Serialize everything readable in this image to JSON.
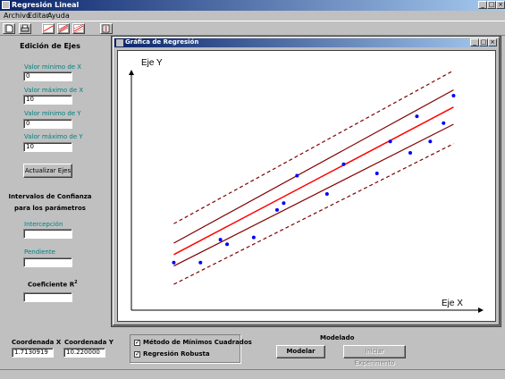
{
  "window": {
    "title": "Regresión Lineal"
  },
  "menu": {
    "items": [
      "Archivo",
      "Editar",
      "Ayuda"
    ]
  },
  "toolbar": {
    "icons": [
      "new-file-icon",
      "print-icon",
      "chart-line-icon",
      "chart-scatter-icon",
      "chart-bands-icon",
      "exit-icon"
    ]
  },
  "axes_panel": {
    "title": "Edición de Ejes",
    "xmin_label": "Valor mínimo de X",
    "xmin_value": "0",
    "xmax_label": "Valor máximo de X",
    "xmax_value": "10",
    "ymin_label": "Valor mínimo de Y",
    "ymin_value": "0",
    "ymax_label": "Valor máximo de Y",
    "ymax_value": "10",
    "update_button": "Actualizar Ejes"
  },
  "confidence": {
    "title_line1": "Intervalos de Confianza",
    "title_line2": "para los parámetros",
    "intercept_label": "Intercepción",
    "intercept_value": "",
    "slope_label": "Pendiente",
    "slope_value": "",
    "r2_label": "Coeficiente R",
    "r2_sup": "2",
    "r2_value": ""
  },
  "graph_window": {
    "title": "Gráfica de Regresión"
  },
  "chart_data": {
    "type": "scatter",
    "title": "",
    "xlabel": "Eje X",
    "ylabel": "Eje Y",
    "xlim": [
      0,
      10
    ],
    "ylim": [
      0,
      10
    ],
    "grid": false,
    "points": [
      {
        "x": 0.2,
        "y": 1.3
      },
      {
        "x": 1.0,
        "y": 1.3
      },
      {
        "x": 1.6,
        "y": 2.3
      },
      {
        "x": 1.8,
        "y": 2.1
      },
      {
        "x": 2.6,
        "y": 2.4
      },
      {
        "x": 3.3,
        "y": 3.6
      },
      {
        "x": 3.5,
        "y": 3.9
      },
      {
        "x": 3.9,
        "y": 5.1
      },
      {
        "x": 4.8,
        "y": 4.3
      },
      {
        "x": 5.3,
        "y": 5.6
      },
      {
        "x": 6.3,
        "y": 5.2
      },
      {
        "x": 6.7,
        "y": 6.6
      },
      {
        "x": 7.3,
        "y": 6.1
      },
      {
        "x": 7.5,
        "y": 7.7
      },
      {
        "x": 7.9,
        "y": 6.6
      },
      {
        "x": 8.3,
        "y": 7.4
      },
      {
        "x": 8.6,
        "y": 8.6
      }
    ],
    "fit_line": {
      "x0": 0.2,
      "y0": 1.65,
      "x1": 8.6,
      "y1": 8.1
    },
    "confidence_band": {
      "upper": {
        "x0": 0.2,
        "y0": 2.15,
        "x1": 8.6,
        "y1": 8.85
      },
      "lower": {
        "x0": 0.2,
        "y0": 1.15,
        "x1": 8.6,
        "y1": 7.35
      }
    },
    "prediction_band": {
      "upper": {
        "x0": 0.2,
        "y0": 3.0,
        "x1": 8.6,
        "y1": 9.7
      },
      "lower": {
        "x0": 0.2,
        "y0": 0.35,
        "x1": 8.6,
        "y1": 6.5
      }
    },
    "colors": {
      "points": "#0000ff",
      "fit": "#ff0000",
      "bands": "#800000"
    }
  },
  "coords": {
    "x_label": "Coordenada X",
    "x_value": "1.7130919",
    "y_label": "Coordenada Y",
    "y_value": "10.220000"
  },
  "methods": {
    "least_squares": "Método de Mínimos Cuadrados",
    "least_squares_checked": true,
    "robust": "Regresión Robusta",
    "robust_checked": true
  },
  "modeling": {
    "title": "Modelado",
    "model_button": "Modelar",
    "experiment_button": "Iniciar Experimento"
  }
}
